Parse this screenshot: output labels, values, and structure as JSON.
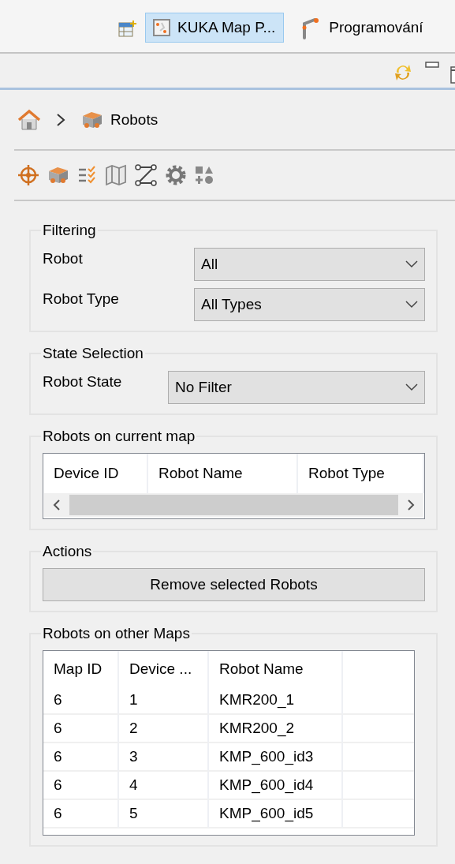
{
  "tabs": [
    {
      "label": "KUKA Map P...",
      "selected": true
    },
    {
      "label": "Programování",
      "selected": false
    }
  ],
  "breadcrumb": {
    "current": "Robots"
  },
  "filtering": {
    "title": "Filtering",
    "fields": [
      {
        "label": "Robot",
        "value": "All"
      },
      {
        "label": "Robot Type",
        "value": "All Types"
      }
    ]
  },
  "state_selection": {
    "title": "State Selection",
    "fields": [
      {
        "label": "Robot State",
        "value": "No Filter"
      }
    ]
  },
  "current_map": {
    "title": "Robots on current map",
    "columns": [
      "Device ID",
      "Robot Name",
      "Robot Type"
    ]
  },
  "actions": {
    "title": "Actions",
    "buttons": [
      "Remove selected Robots"
    ]
  },
  "other_maps": {
    "title": "Robots on other Maps",
    "columns": [
      "Map ID",
      "Device ...",
      "Robot Name"
    ],
    "rows": [
      [
        "6",
        "1",
        "KMR200_1"
      ],
      [
        "6",
        "2",
        "KMR200_2"
      ],
      [
        "6",
        "3",
        "KMP_600_id3"
      ],
      [
        "6",
        "4",
        "KMP_600_id4"
      ],
      [
        "6",
        "5",
        "KMP_600_id5"
      ]
    ]
  }
}
